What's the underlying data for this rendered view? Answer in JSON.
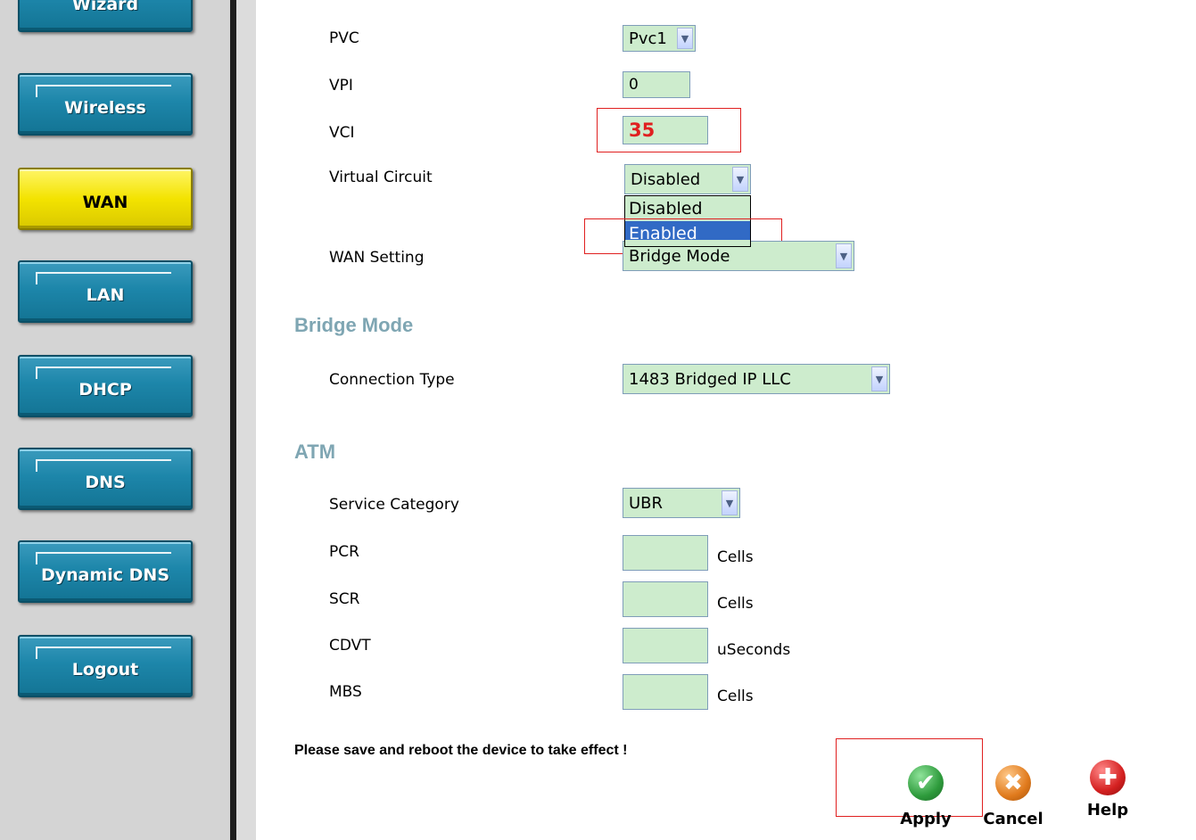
{
  "sidebar": {
    "items": [
      {
        "label": "Wizard"
      },
      {
        "label": "Wireless"
      },
      {
        "label": "WAN"
      },
      {
        "label": "LAN"
      },
      {
        "label": "DHCP"
      },
      {
        "label": "DNS"
      },
      {
        "label": "Dynamic DNS"
      },
      {
        "label": "Logout"
      }
    ],
    "active": "WAN"
  },
  "form": {
    "pvc": {
      "label": "PVC",
      "value": "Pvc1"
    },
    "vpi": {
      "label": "VPI",
      "value": "0"
    },
    "vci": {
      "label": "VCI",
      "value": "35"
    },
    "virtual_circuit": {
      "label": "Virtual Circuit",
      "value": "Disabled",
      "options": [
        "Disabled",
        "Enabled"
      ],
      "highlighted_option": "Enabled"
    },
    "wan_setting": {
      "label": "WAN Setting",
      "value": "Bridge Mode"
    }
  },
  "bridge_mode": {
    "title": "Bridge Mode",
    "connection_type": {
      "label": "Connection Type",
      "value": "1483 Bridged IP LLC"
    }
  },
  "atm": {
    "title": "ATM",
    "service_category": {
      "label": "Service Category",
      "value": "UBR"
    },
    "pcr": {
      "label": "PCR",
      "value": "",
      "unit": "Cells"
    },
    "scr": {
      "label": "SCR",
      "value": "",
      "unit": "Cells"
    },
    "cdvt": {
      "label": "CDVT",
      "value": "",
      "unit": "uSeconds"
    },
    "mbs": {
      "label": "MBS",
      "value": "",
      "unit": "Cells"
    }
  },
  "notice": "Please save and reboot the device to take effect !",
  "actions": {
    "apply": "Apply",
    "cancel": "Cancel",
    "help": "Help"
  },
  "colors": {
    "highlight": "#e02020",
    "field_bg": "#cdeccd",
    "nav_blue": "#1d86aa",
    "nav_active": "#f3e300",
    "section_title": "#7fa6b3",
    "apply_icon": "#2e9b3c",
    "cancel_icon": "#e07a1c",
    "help_icon": "#d42020"
  },
  "icons": {
    "select_arrow": "chevron-down-icon",
    "apply": "check-icon",
    "cancel": "x-icon",
    "help": "plus-icon"
  }
}
